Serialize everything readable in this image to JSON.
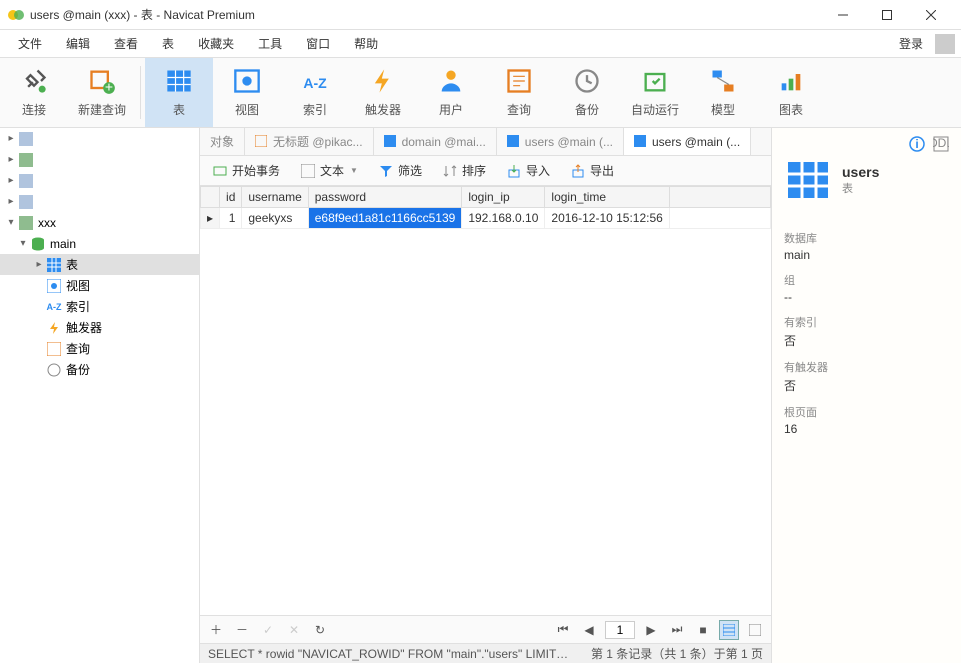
{
  "window": {
    "title": "users @main (xxx) - 表 - Navicat Premium"
  },
  "menu": {
    "items": [
      "文件",
      "编辑",
      "查看",
      "表",
      "收藏夹",
      "工具",
      "窗口",
      "帮助"
    ],
    "login": "登录"
  },
  "toolbar": {
    "connect": "连接",
    "newQuery": "新建查询",
    "table": "表",
    "view": "视图",
    "index": "索引",
    "trigger": "触发器",
    "user": "用户",
    "query": "查询",
    "backup": "备份",
    "automation": "自动运行",
    "model": "模型",
    "chart": "图表"
  },
  "tree": {
    "conn1": "",
    "conn2": "",
    "conn3": "",
    "conn4": "",
    "conn5": "xxx",
    "db": "main",
    "nodes": {
      "tables": "表",
      "views": "视图",
      "indexes": "索引",
      "triggers": "触发器",
      "queries": "查询",
      "backups": "备份"
    }
  },
  "tabs": {
    "objects": "对象",
    "t1": "无标题 @pikac...",
    "t2": "domain @mai...",
    "t3": "users @main (...",
    "t4": "users @main (..."
  },
  "subtoolbar": {
    "beginTx": "开始事务",
    "text": "文本",
    "filter": "筛选",
    "sort": "排序",
    "import": "导入",
    "export": "导出"
  },
  "grid": {
    "columns": [
      "id",
      "username",
      "password",
      "login_ip",
      "login_time"
    ],
    "rows": [
      {
        "id": "1",
        "username": "geekyxs",
        "password": "e68f9ed1a81c1166cc5139",
        "login_ip": "192.168.0.10",
        "login_time": "2016-12-10 15:12:56"
      }
    ]
  },
  "pager": {
    "page": "1"
  },
  "status": {
    "left": "SELECT * rowid \"NAVICAT_ROWID\" FROM \"main\".\"users\" LIMIT 0,...",
    "right": "第 1 条记录（共 1 条）于第 1 页"
  },
  "info": {
    "title": "users",
    "subtitle": "表",
    "fields": {
      "dbLabel": "数据库",
      "db": "main",
      "groupLabel": "组",
      "group": "--",
      "hasIndexLabel": "有索引",
      "hasIndex": "否",
      "hasTriggerLabel": "有触发器",
      "hasTrigger": "否",
      "rootPageLabel": "根页面",
      "rootPage": "16"
    }
  }
}
